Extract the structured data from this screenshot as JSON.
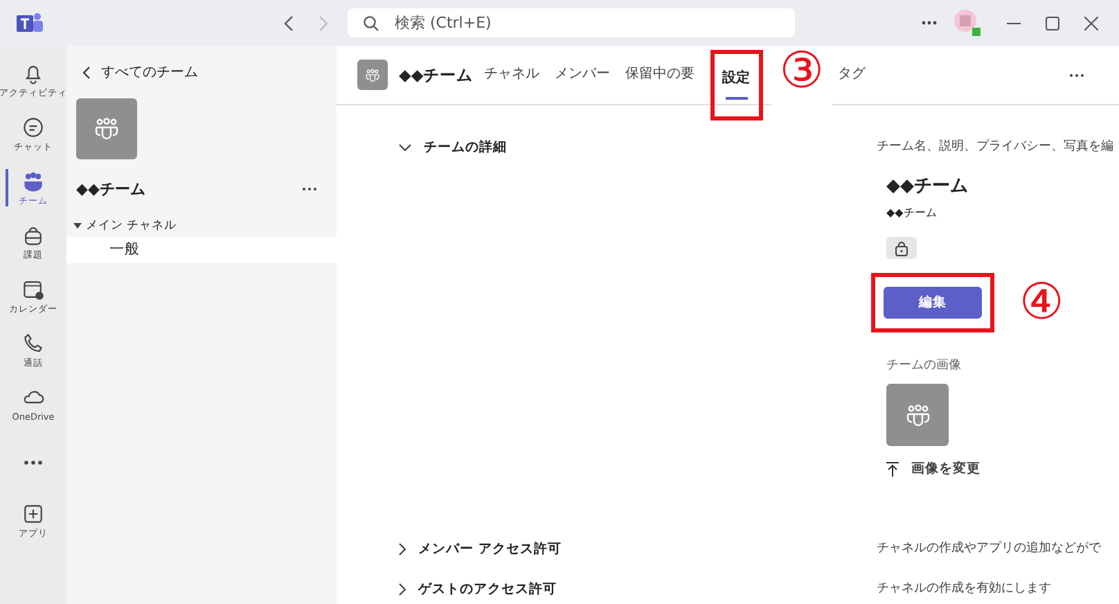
{
  "titlebar": {
    "search": {
      "placeholder": "検索 (Ctrl+E)"
    }
  },
  "rail": [
    {
      "label": "アクティビティ",
      "selected": false
    },
    {
      "label": "チャット",
      "selected": false
    },
    {
      "label": "チーム",
      "selected": true
    },
    {
      "label": "課題",
      "selected": false
    },
    {
      "label": "カレンダー",
      "selected": false
    },
    {
      "label": "通話",
      "selected": false
    },
    {
      "label": "OneDrive",
      "selected": false
    },
    {
      "selected": false
    },
    {
      "label": "アプリ",
      "selected": false
    }
  ],
  "channel_pane": {
    "back": "すべてのチーム",
    "team_name": "◆◆チーム",
    "group": "メイン チャネル",
    "channels": [
      {
        "name": "一般",
        "selected": true
      }
    ]
  },
  "header": {
    "team_name": "◆◆チーム",
    "tabs": [
      {
        "label": "チャネル",
        "selected": false
      },
      {
        "label": "メンバー",
        "selected": false
      },
      {
        "label": "保留中の要",
        "selected": false
      },
      {
        "label": "設定",
        "selected": true
      },
      {
        "label": "タグ",
        "selected": false
      }
    ]
  },
  "sections": [
    {
      "title": "チームの詳細",
      "expanded": true,
      "summary": "チーム名、説明、プライバシー、写真を編",
      "details": {
        "name": "◆◆チーム",
        "description": "◆◆チーム",
        "edit": "編集",
        "image_label": "チームの画像",
        "change_image": "画像を変更"
      }
    },
    {
      "title": "メンバー アクセス許可",
      "expanded": false,
      "summary": "チャネルの作成やアプリの追加などがで"
    },
    {
      "title": "ゲストのアクセス許可",
      "expanded": false,
      "summary": "チャネルの作成を有効にします"
    }
  ],
  "annotations": [
    {
      "label": "③"
    },
    {
      "label": "④"
    }
  ]
}
